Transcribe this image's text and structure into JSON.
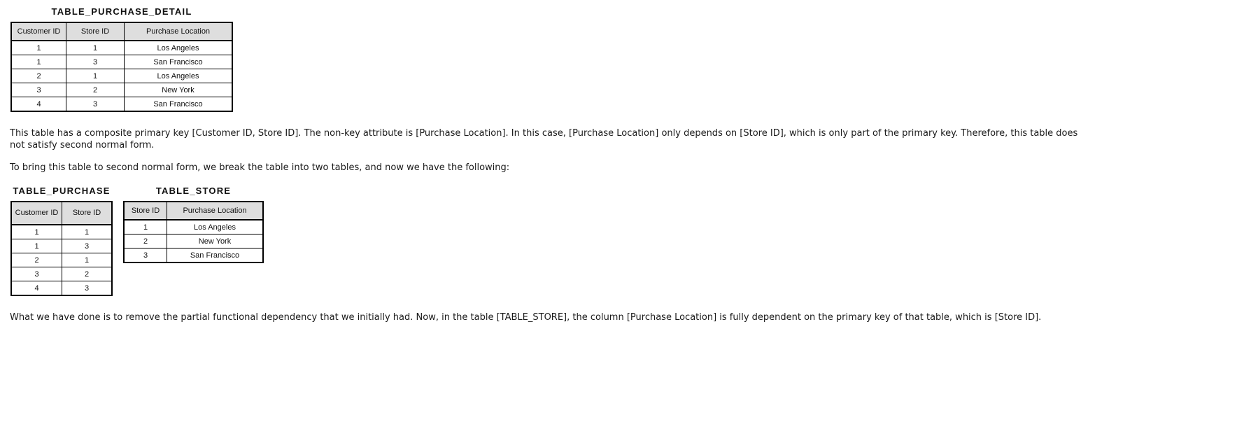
{
  "detail_table": {
    "title": "TABLE_PURCHASE_DETAIL",
    "headers": [
      "Customer ID",
      "Store ID",
      "Purchase Location"
    ],
    "rows": [
      [
        "1",
        "1",
        "Los Angeles"
      ],
      [
        "1",
        "3",
        "San Francisco"
      ],
      [
        "2",
        "1",
        "Los Angeles"
      ],
      [
        "3",
        "2",
        "New York"
      ],
      [
        "4",
        "3",
        "San Francisco"
      ]
    ]
  },
  "paragraph_1": "This table has a composite primary key [Customer ID, Store ID]. The non-key attribute is [Purchase Location]. In this case, [Purchase Location] only depends on [Store ID], which is only part of the primary key. Therefore, this table does not satisfy second normal form.",
  "paragraph_2": "To bring this table to second normal form, we break the table into two tables, and now we have the following:",
  "purchase_table": {
    "title": "TABLE_PURCHASE",
    "headers": [
      "Customer ID",
      "Store ID"
    ],
    "rows": [
      [
        "1",
        "1"
      ],
      [
        "1",
        "3"
      ],
      [
        "2",
        "1"
      ],
      [
        "3",
        "2"
      ],
      [
        "4",
        "3"
      ]
    ]
  },
  "store_table": {
    "title": "TABLE_STORE",
    "headers": [
      "Store ID",
      "Purchase Location"
    ],
    "rows": [
      [
        "1",
        "Los Angeles"
      ],
      [
        "2",
        "New York"
      ],
      [
        "3",
        "San Francisco"
      ]
    ]
  },
  "paragraph_3": "What we have done is to remove the partial functional dependency that we initially had. Now, in the table [TABLE_STORE], the column [Purchase Location] is fully dependent on the primary key of that table, which is [Store ID]."
}
